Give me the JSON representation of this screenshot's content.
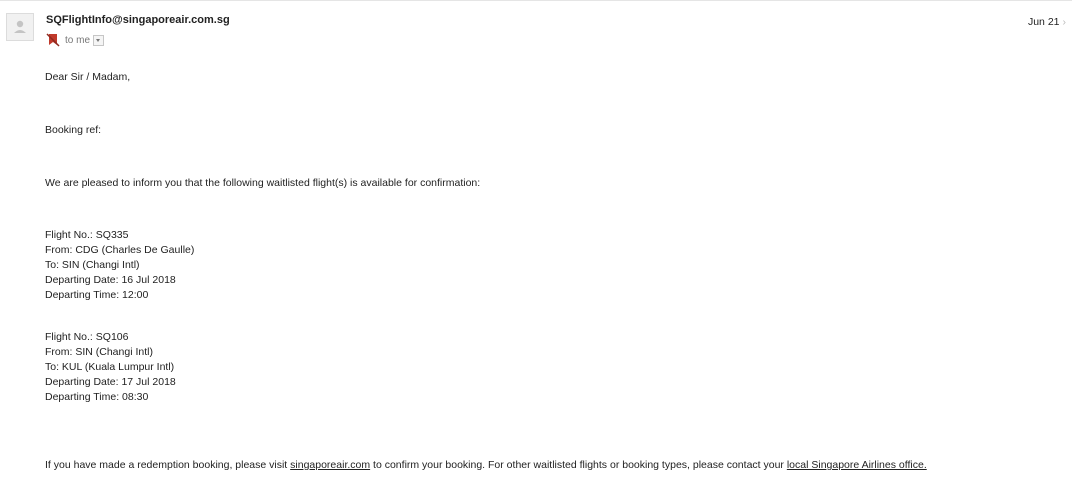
{
  "email": {
    "sender": "SQFlightInfo@singaporeair.com.sg",
    "date": "Jun 21",
    "recipient": "to me",
    "greeting": "Dear Sir / Madam,",
    "booking_ref_label": "Booking ref:",
    "intro": "We are pleased to inform you that the following waitlisted flight(s) is available for confirmation:",
    "flights": [
      {
        "flight_no": "Flight No.: SQ335",
        "from": "From: CDG (Charles De Gaulle)",
        "to": "To: SIN (Changi Intl)",
        "date": "Departing Date: 16 Jul 2018",
        "time": "Departing Time: 12:00"
      },
      {
        "flight_no": "Flight No.: SQ106",
        "from": "From: SIN (Changi Intl)",
        "to": "To: KUL (Kuala Lumpur Intl)",
        "date": "Departing Date: 17 Jul 2018",
        "time": "Departing Time: 08:30"
      }
    ],
    "footer": {
      "part1": "If you have made a redemption booking, please visit ",
      "link1": "singaporeair.com",
      "part2": " to confirm your booking. For other waitlisted flights or booking types, please contact your ",
      "link2": "local Singapore Airlines office."
    }
  },
  "icons": {
    "avatar": "person-avatar-icon",
    "label": "important-marker-icon",
    "dropdown": "chevron-down-icon"
  },
  "colors": {
    "text": "#222222",
    "muted": "#777777",
    "marker": "#c0392b"
  }
}
